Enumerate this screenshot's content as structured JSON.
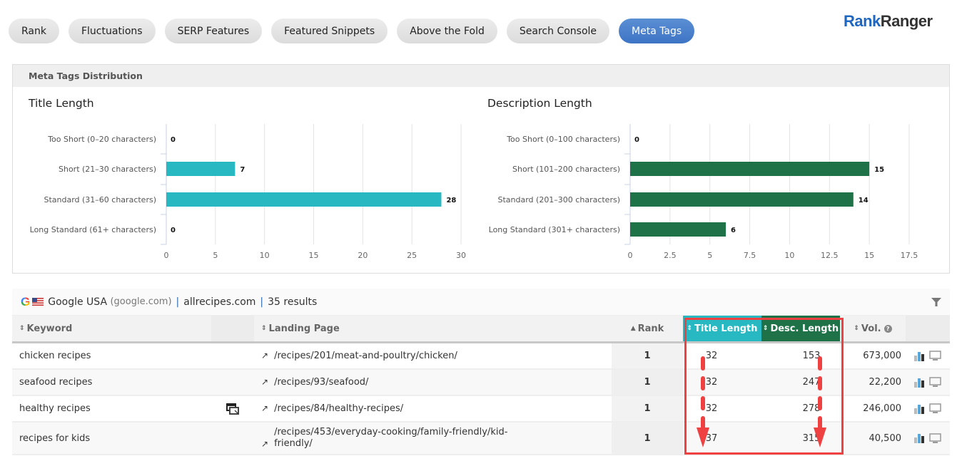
{
  "tabs": [
    {
      "label": "Rank",
      "active": false
    },
    {
      "label": "Fluctuations",
      "active": false
    },
    {
      "label": "SERP Features",
      "active": false
    },
    {
      "label": "Featured Snippets",
      "active": false
    },
    {
      "label": "Above the Fold",
      "active": false
    },
    {
      "label": "Search Console",
      "active": false
    },
    {
      "label": "Meta Tags",
      "active": true
    }
  ],
  "logo": {
    "part1": "Rank",
    "part2": "Ranger"
  },
  "panel": {
    "title": "Meta Tags Distribution"
  },
  "chart_data": [
    {
      "type": "bar",
      "orientation": "horizontal",
      "title": "Title Length",
      "categories": [
        "Too Short (0–20 characters)",
        "Short (21–30 characters)",
        "Standard (31–60 characters)",
        "Long Standard (61+ characters)"
      ],
      "values": [
        0,
        7,
        28,
        0
      ],
      "xlim": [
        0,
        30
      ],
      "xticks": [
        "0",
        "5",
        "10",
        "15",
        "20",
        "25",
        "30"
      ],
      "color": "#27b8c2",
      "grid": true,
      "data_labels": true
    },
    {
      "type": "bar",
      "orientation": "horizontal",
      "title": "Description Length",
      "categories": [
        "Too Short (0–100 characters)",
        "Short (101–200 characters)",
        "Standard (201–300 characters)",
        "Long Standard (301+ characters)"
      ],
      "values": [
        0,
        15,
        14,
        6
      ],
      "xlim": [
        0,
        17.5
      ],
      "xticks": [
        "0",
        "2.5",
        "5",
        "7.5",
        "10",
        "12.5",
        "15",
        "17.5"
      ],
      "color": "#1f7148",
      "grid": true,
      "data_labels": true
    }
  ],
  "table": {
    "engine": "Google USA",
    "engine_domain": "(google.com)",
    "site": "allrecipes.com",
    "results": "35 results",
    "columns": {
      "keyword": "Keyword",
      "landing": "Landing Page",
      "rank": "Rank",
      "title_length": "Title Length",
      "desc_length": "Desc. Length",
      "vol": "Vol."
    },
    "rows": [
      {
        "keyword": "chicken recipes",
        "landing": "/recipes/201/meat-and-poultry/chicken/",
        "rank": "1",
        "title_length": "32",
        "desc_length": "153",
        "vol": "673,000",
        "has_snippet_icon": false
      },
      {
        "keyword": "seafood recipes",
        "landing": "/recipes/93/seafood/",
        "rank": "1",
        "title_length": "32",
        "desc_length": "247",
        "vol": "22,200",
        "has_snippet_icon": false
      },
      {
        "keyword": "healthy recipes",
        "landing": "/recipes/84/healthy-recipes/",
        "rank": "1",
        "title_length": "32",
        "desc_length": "278",
        "vol": "246,000",
        "has_snippet_icon": true
      },
      {
        "keyword": "recipes for kids",
        "landing": "/recipes/453/everyday-cooking/family-friendly/kid-friendly/",
        "rank": "1",
        "title_length": "37",
        "desc_length": "315",
        "vol": "40,500",
        "has_snippet_icon": false
      }
    ]
  },
  "colors": {
    "accent_blue": "#3d74c4",
    "title_bar": "#27b8c2",
    "desc_bar": "#1f7148",
    "highlight": "#ef4141"
  }
}
